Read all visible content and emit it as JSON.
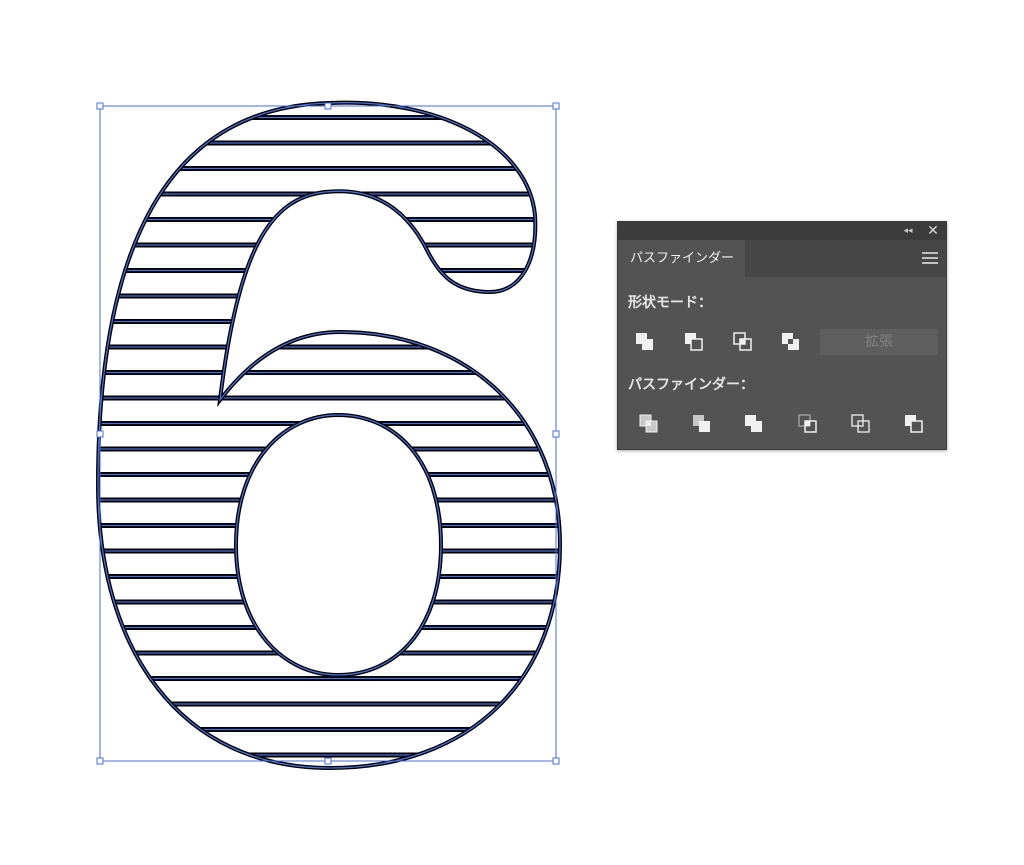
{
  "artwork": {
    "glyph": "6",
    "colors": {
      "stroke": "#000000",
      "selection": "#4a6fd8",
      "fill": "#ffffff"
    }
  },
  "panel": {
    "tab_label": "パスファインダー",
    "collapse_glyph": "◂◂",
    "close_glyph": "✕",
    "shape_modes_label": "形状モード：",
    "expand_label": "拡張",
    "pathfinders_label": "パスファインダー："
  }
}
